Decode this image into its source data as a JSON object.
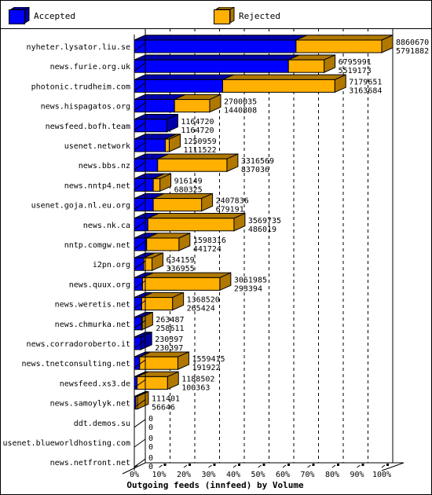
{
  "chart_data": {
    "type": "bar",
    "orientation": "horizontal",
    "stacked": true,
    "percent_scale": true,
    "title": "Outgoing feeds (innfeed) by Volume",
    "xlabel": "Outgoing feeds (innfeed) by Volume",
    "ylabel": "",
    "xlim": [
      0,
      100
    ],
    "x_ticks": [
      "0%",
      "10%",
      "20%",
      "30%",
      "40%",
      "50%",
      "60%",
      "70%",
      "80%",
      "90%",
      "100%"
    ],
    "grid": true,
    "legend_position": "top",
    "scale_max": 8860670,
    "legend": [
      {
        "name": "Accepted",
        "color": "#0000ff",
        "dark": "#0000aa"
      },
      {
        "name": "Rejected",
        "color": "#ffb000",
        "dark": "#b07800"
      }
    ],
    "categories": [
      "nyheter.lysator.liu.se",
      "news.furie.org.uk",
      "photonic.trudheim.com",
      "news.hispagatos.org",
      "newsfeed.bofh.team",
      "usenet.network",
      "news.bbs.nz",
      "news.nntp4.net",
      "usenet.goja.nl.eu.org",
      "news.nk.ca",
      "nntp.comgw.net",
      "i2pn.org",
      "news.quux.org",
      "news.weretis.net",
      "news.chmurka.net",
      "news.corradoroberto.it",
      "news.tnetconsulting.net",
      "newsfeed.xs3.de",
      "news.samoylyk.net",
      "ddt.demos.su",
      "usenet.blueworldhosting.com",
      "news.netfront.net"
    ],
    "totals": [
      8860670,
      6795991,
      7179651,
      2700035,
      1164720,
      1250959,
      3316569,
      916149,
      2407836,
      3569735,
      1598316,
      634159,
      3061985,
      1368520,
      263487,
      230397,
      1559415,
      1188502,
      111401,
      0,
      0,
      0
    ],
    "series": [
      {
        "name": "Accepted",
        "values": [
          5791882,
          5519173,
          3163684,
          1440808,
          1164720,
          1111522,
          837036,
          680325,
          679191,
          486019,
          441724,
          336955,
          293394,
          265424,
          258611,
          230397,
          191922,
          100363,
          56646,
          0,
          0,
          0
        ]
      },
      {
        "name": "Rejected",
        "values": [
          3068788,
          1276818,
          4015967,
          1259227,
          0,
          139437,
          2479533,
          235824,
          1728645,
          3083716,
          1156592,
          297204,
          2768591,
          1103096,
          4876,
          0,
          1367493,
          1088139,
          54755,
          0,
          0,
          0
        ]
      }
    ],
    "labels_top": [
      "8860670",
      "6795991",
      "7179651",
      "2700035",
      "1164720",
      "1250959",
      "3316569",
      "916149",
      "2407836",
      "3569735",
      "1598316",
      "634159",
      "3061985",
      "1368520",
      "263487",
      "230397",
      "1559415",
      "1188502",
      "111401",
      "0",
      "0",
      "0"
    ],
    "labels_bottom": [
      "5791882",
      "5519173",
      "3163684",
      "1440808",
      "1164720",
      "1111522",
      "837036",
      "680325",
      "679191",
      "486019",
      "441724",
      "336955",
      "293394",
      "265424",
      "258611",
      "230397",
      "191922",
      "100363",
      "56646",
      "0",
      "0",
      "0"
    ]
  }
}
